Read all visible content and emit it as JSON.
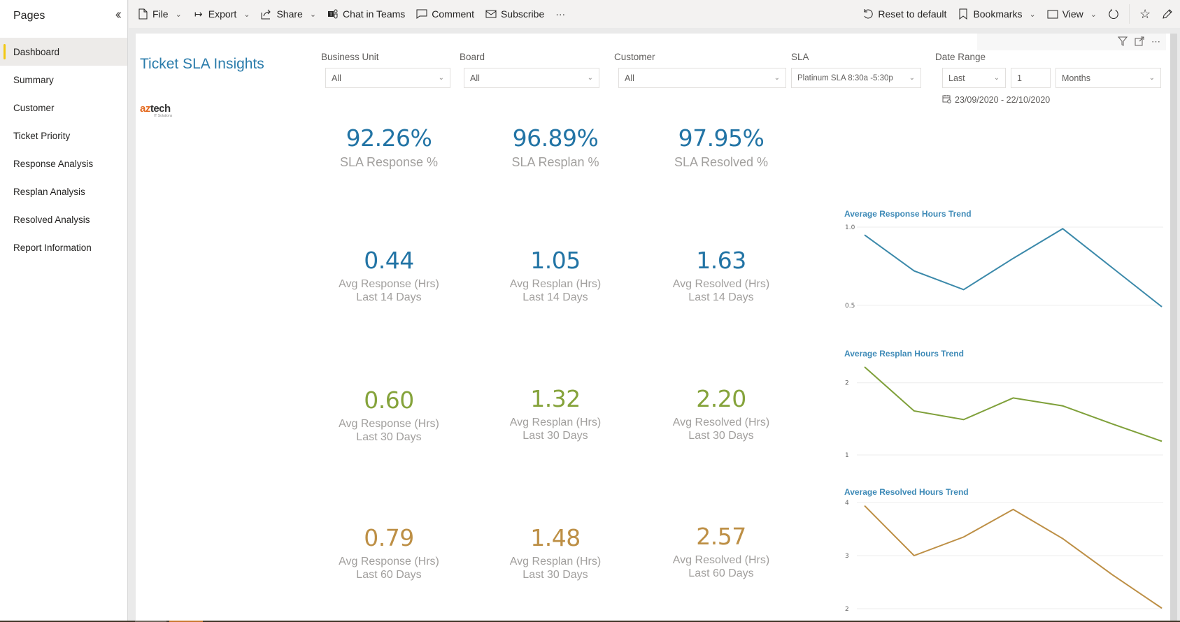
{
  "sidebar": {
    "title": "Pages",
    "collapse_icon": "double-chevron-left-icon",
    "items": [
      {
        "label": "Dashboard",
        "active": true
      },
      {
        "label": "Summary"
      },
      {
        "label": "Customer"
      },
      {
        "label": "Ticket Priority"
      },
      {
        "label": "Response Analysis"
      },
      {
        "label": "Resplan Analysis"
      },
      {
        "label": "Resolved Analysis"
      },
      {
        "label": "Report Information"
      }
    ]
  },
  "toolbar": {
    "file": "File",
    "export": "Export",
    "share": "Share",
    "chat_in_teams": "Chat in Teams",
    "comment": "Comment",
    "subscribe": "Subscribe",
    "more": "···",
    "reset": "Reset to default",
    "bookmarks": "Bookmarks",
    "view": "View"
  },
  "report": {
    "title": "Ticket SLA Insights",
    "logo": {
      "az": "az",
      "tech": "tech",
      "sub": "IT Solutions"
    }
  },
  "slicers": {
    "business_unit": {
      "label": "Business Unit",
      "value": "All"
    },
    "board": {
      "label": "Board",
      "value": "All"
    },
    "customer": {
      "label": "Customer",
      "value": "All"
    },
    "sla": {
      "label": "SLA",
      "value": "Platinum SLA 8:30a -5:30p"
    },
    "date_range": {
      "label": "Date Range",
      "mode": "Last",
      "count": "1",
      "unit": "Months",
      "display": "23/09/2020 - 22/10/2020"
    }
  },
  "kpis": {
    "sla": [
      {
        "value": "92.26%",
        "label": "SLA Response %"
      },
      {
        "value": "96.89%",
        "label": "SLA Resplan %"
      },
      {
        "value": "97.95%",
        "label": "SLA Resolved %"
      }
    ],
    "days14": [
      {
        "value": "0.44",
        "label": "Avg Response (Hrs) Last 14 Days"
      },
      {
        "value": "1.05",
        "label": "Avg Resplan (Hrs) Last 14 Days"
      },
      {
        "value": "1.63",
        "label": "Avg Resolved (Hrs) Last 14 Days"
      }
    ],
    "days30": [
      {
        "value": "0.60",
        "label": "Avg Response (Hrs) Last 30 Days"
      },
      {
        "value": "1.32",
        "label": "Avg Resplan (Hrs) Last 30 Days"
      },
      {
        "value": "2.20",
        "label": "Avg Resolved (Hrs) Last 30 Days"
      }
    ],
    "days60": [
      {
        "value": "0.79",
        "label": "Avg Response (Hrs) Last 60 Days"
      },
      {
        "value": "1.48",
        "label": "Avg Resplan (Hrs) Last 30 Days"
      },
      {
        "value": "2.57",
        "label": "Avg Resolved (Hrs) Last 60 Days"
      }
    ]
  },
  "colors": {
    "blue": "#2274a5",
    "green": "#85a33b",
    "gold": "#bd8f45",
    "title_blue": "#2b7cab",
    "active_page_marker": "#f2c811",
    "response_line": "#3b89aa",
    "resplan_line": "#7fa03a",
    "resolved_line": "#bd8f45"
  },
  "chart_data": [
    {
      "type": "line",
      "title": "Average Response Hours Trend",
      "xlabel": "",
      "ylabel": "",
      "yticks": [
        0.5,
        1.0
      ],
      "ytick_labels": [
        "0.5",
        "1.0"
      ],
      "ylim": [
        0.48,
        1.0
      ],
      "grid": true,
      "series": [
        {
          "name": "Average Response Hours",
          "color": "#3b89aa",
          "values": [
            0.95,
            0.72,
            0.6,
            0.8,
            0.99,
            0.74,
            0.49
          ]
        }
      ]
    },
    {
      "type": "line",
      "title": "Average Resplan Hours Trend",
      "xlabel": "",
      "ylabel": "",
      "yticks": [
        1,
        2
      ],
      "ytick_labels": [
        "1",
        "2"
      ],
      "ylim": [
        1.0,
        2.3
      ],
      "grid": true,
      "series": [
        {
          "name": "Average Resplan Hours",
          "color": "#7fa03a",
          "values": [
            2.22,
            1.61,
            1.49,
            1.79,
            1.68,
            1.43,
            1.19
          ]
        }
      ]
    },
    {
      "type": "line",
      "title": "Average Resolved Hours Trend",
      "xlabel": "",
      "ylabel": "",
      "yticks": [
        2,
        3,
        4
      ],
      "ytick_labels": [
        "2",
        "3",
        "4"
      ],
      "ylim": [
        2.0,
        4.0
      ],
      "grid": true,
      "series": [
        {
          "name": "Average Resolved Hours",
          "color": "#bd8f45",
          "values": [
            3.94,
            3.0,
            3.35,
            3.87,
            3.32,
            2.64,
            2.01
          ]
        }
      ]
    }
  ]
}
